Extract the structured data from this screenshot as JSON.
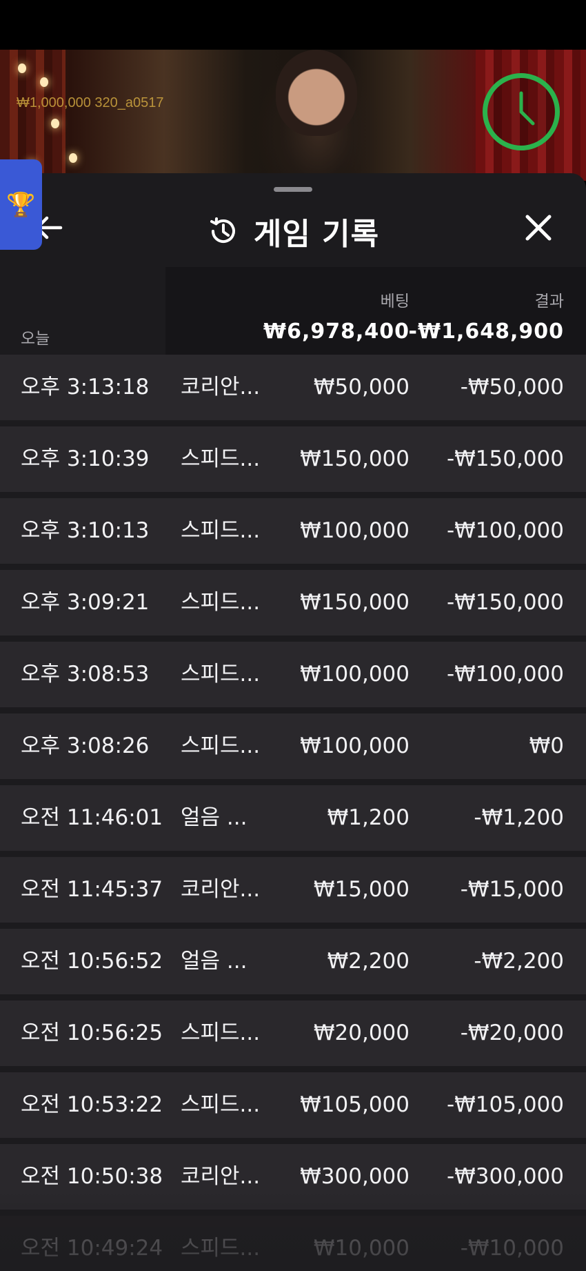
{
  "video": {
    "info": "₩1,000,000  320_a0517"
  },
  "panel": {
    "title": "게임 기록",
    "columns": {
      "bet": "베팅",
      "result": "결과"
    },
    "summary": {
      "label": "오늘",
      "bet_total": "₩6,978,400",
      "result_total": "-₩1,648,900"
    },
    "rows": [
      {
        "time": "오후 3:13:18",
        "game": "코리안...",
        "bet": "₩50,000",
        "result": "-₩50,000"
      },
      {
        "time": "오후 3:10:39",
        "game": "스피드...",
        "bet": "₩150,000",
        "result": "-₩150,000"
      },
      {
        "time": "오후 3:10:13",
        "game": "스피드...",
        "bet": "₩100,000",
        "result": "-₩100,000"
      },
      {
        "time": "오후 3:09:21",
        "game": "스피드...",
        "bet": "₩150,000",
        "result": "-₩150,000"
      },
      {
        "time": "오후 3:08:53",
        "game": "스피드...",
        "bet": "₩100,000",
        "result": "-₩100,000"
      },
      {
        "time": "오후 3:08:26",
        "game": "스피드...",
        "bet": "₩100,000",
        "result": "₩0"
      },
      {
        "time": "오전 11:46:01",
        "game": "얼음 ...",
        "bet": "₩1,200",
        "result": "-₩1,200"
      },
      {
        "time": "오전 11:45:37",
        "game": "코리안...",
        "bet": "₩15,000",
        "result": "-₩15,000"
      },
      {
        "time": "오전 10:56:52",
        "game": "얼음 ...",
        "bet": "₩2,200",
        "result": "-₩2,200"
      },
      {
        "time": "오전 10:56:25",
        "game": "스피드...",
        "bet": "₩20,000",
        "result": "-₩20,000"
      },
      {
        "time": "오전 10:53:22",
        "game": "스피드...",
        "bet": "₩105,000",
        "result": "-₩105,000"
      },
      {
        "time": "오전 10:50:38",
        "game": "코리안...",
        "bet": "₩300,000",
        "result": "-₩300,000"
      },
      {
        "time": "오전 10:49:24",
        "game": "스피드...",
        "bet": "₩10,000",
        "result": "-₩10,000"
      }
    ]
  },
  "icons": {
    "back": "arrow-left-icon",
    "history": "history-icon",
    "close": "close-icon",
    "trophy": "trophy-icon",
    "timer": "clock-timer-icon"
  },
  "colors": {
    "timer_ring": "#2bb24c",
    "trophy_tab": "#3a59d6",
    "panel_bg": "#1c1b1e",
    "row_bg": "#2a282c"
  }
}
